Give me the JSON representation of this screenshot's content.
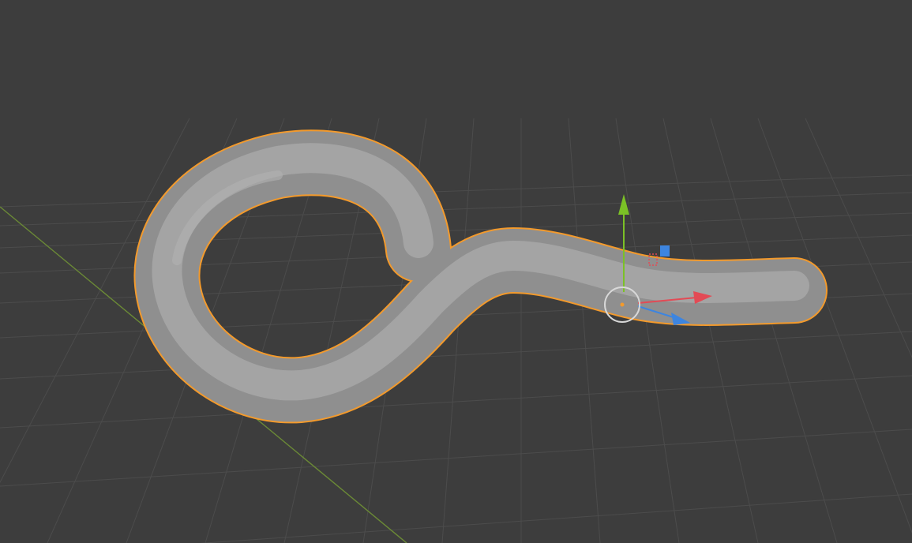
{
  "viewport": {
    "mode": "3d-viewport",
    "shading": "solid",
    "background_color": "#3d3d3d",
    "grid": true,
    "grid_color": "#4c4c4c",
    "x_axis_line_color": "#6b8a36"
  },
  "selected_object": {
    "type": "curve",
    "shape": "hook",
    "selected": true,
    "mesh_color": "#9a9a9a",
    "outline_color": "#f39a2c"
  },
  "transform_gizmo": {
    "visible": true,
    "axes": [
      {
        "name": "x",
        "color": "#e34a55"
      },
      {
        "name": "y",
        "color": "#7bc126"
      },
      {
        "name": "z",
        "color": "#3d85e0"
      }
    ],
    "center_ring_color": "#d8d8d8",
    "origin_color": "#f39a2c"
  }
}
